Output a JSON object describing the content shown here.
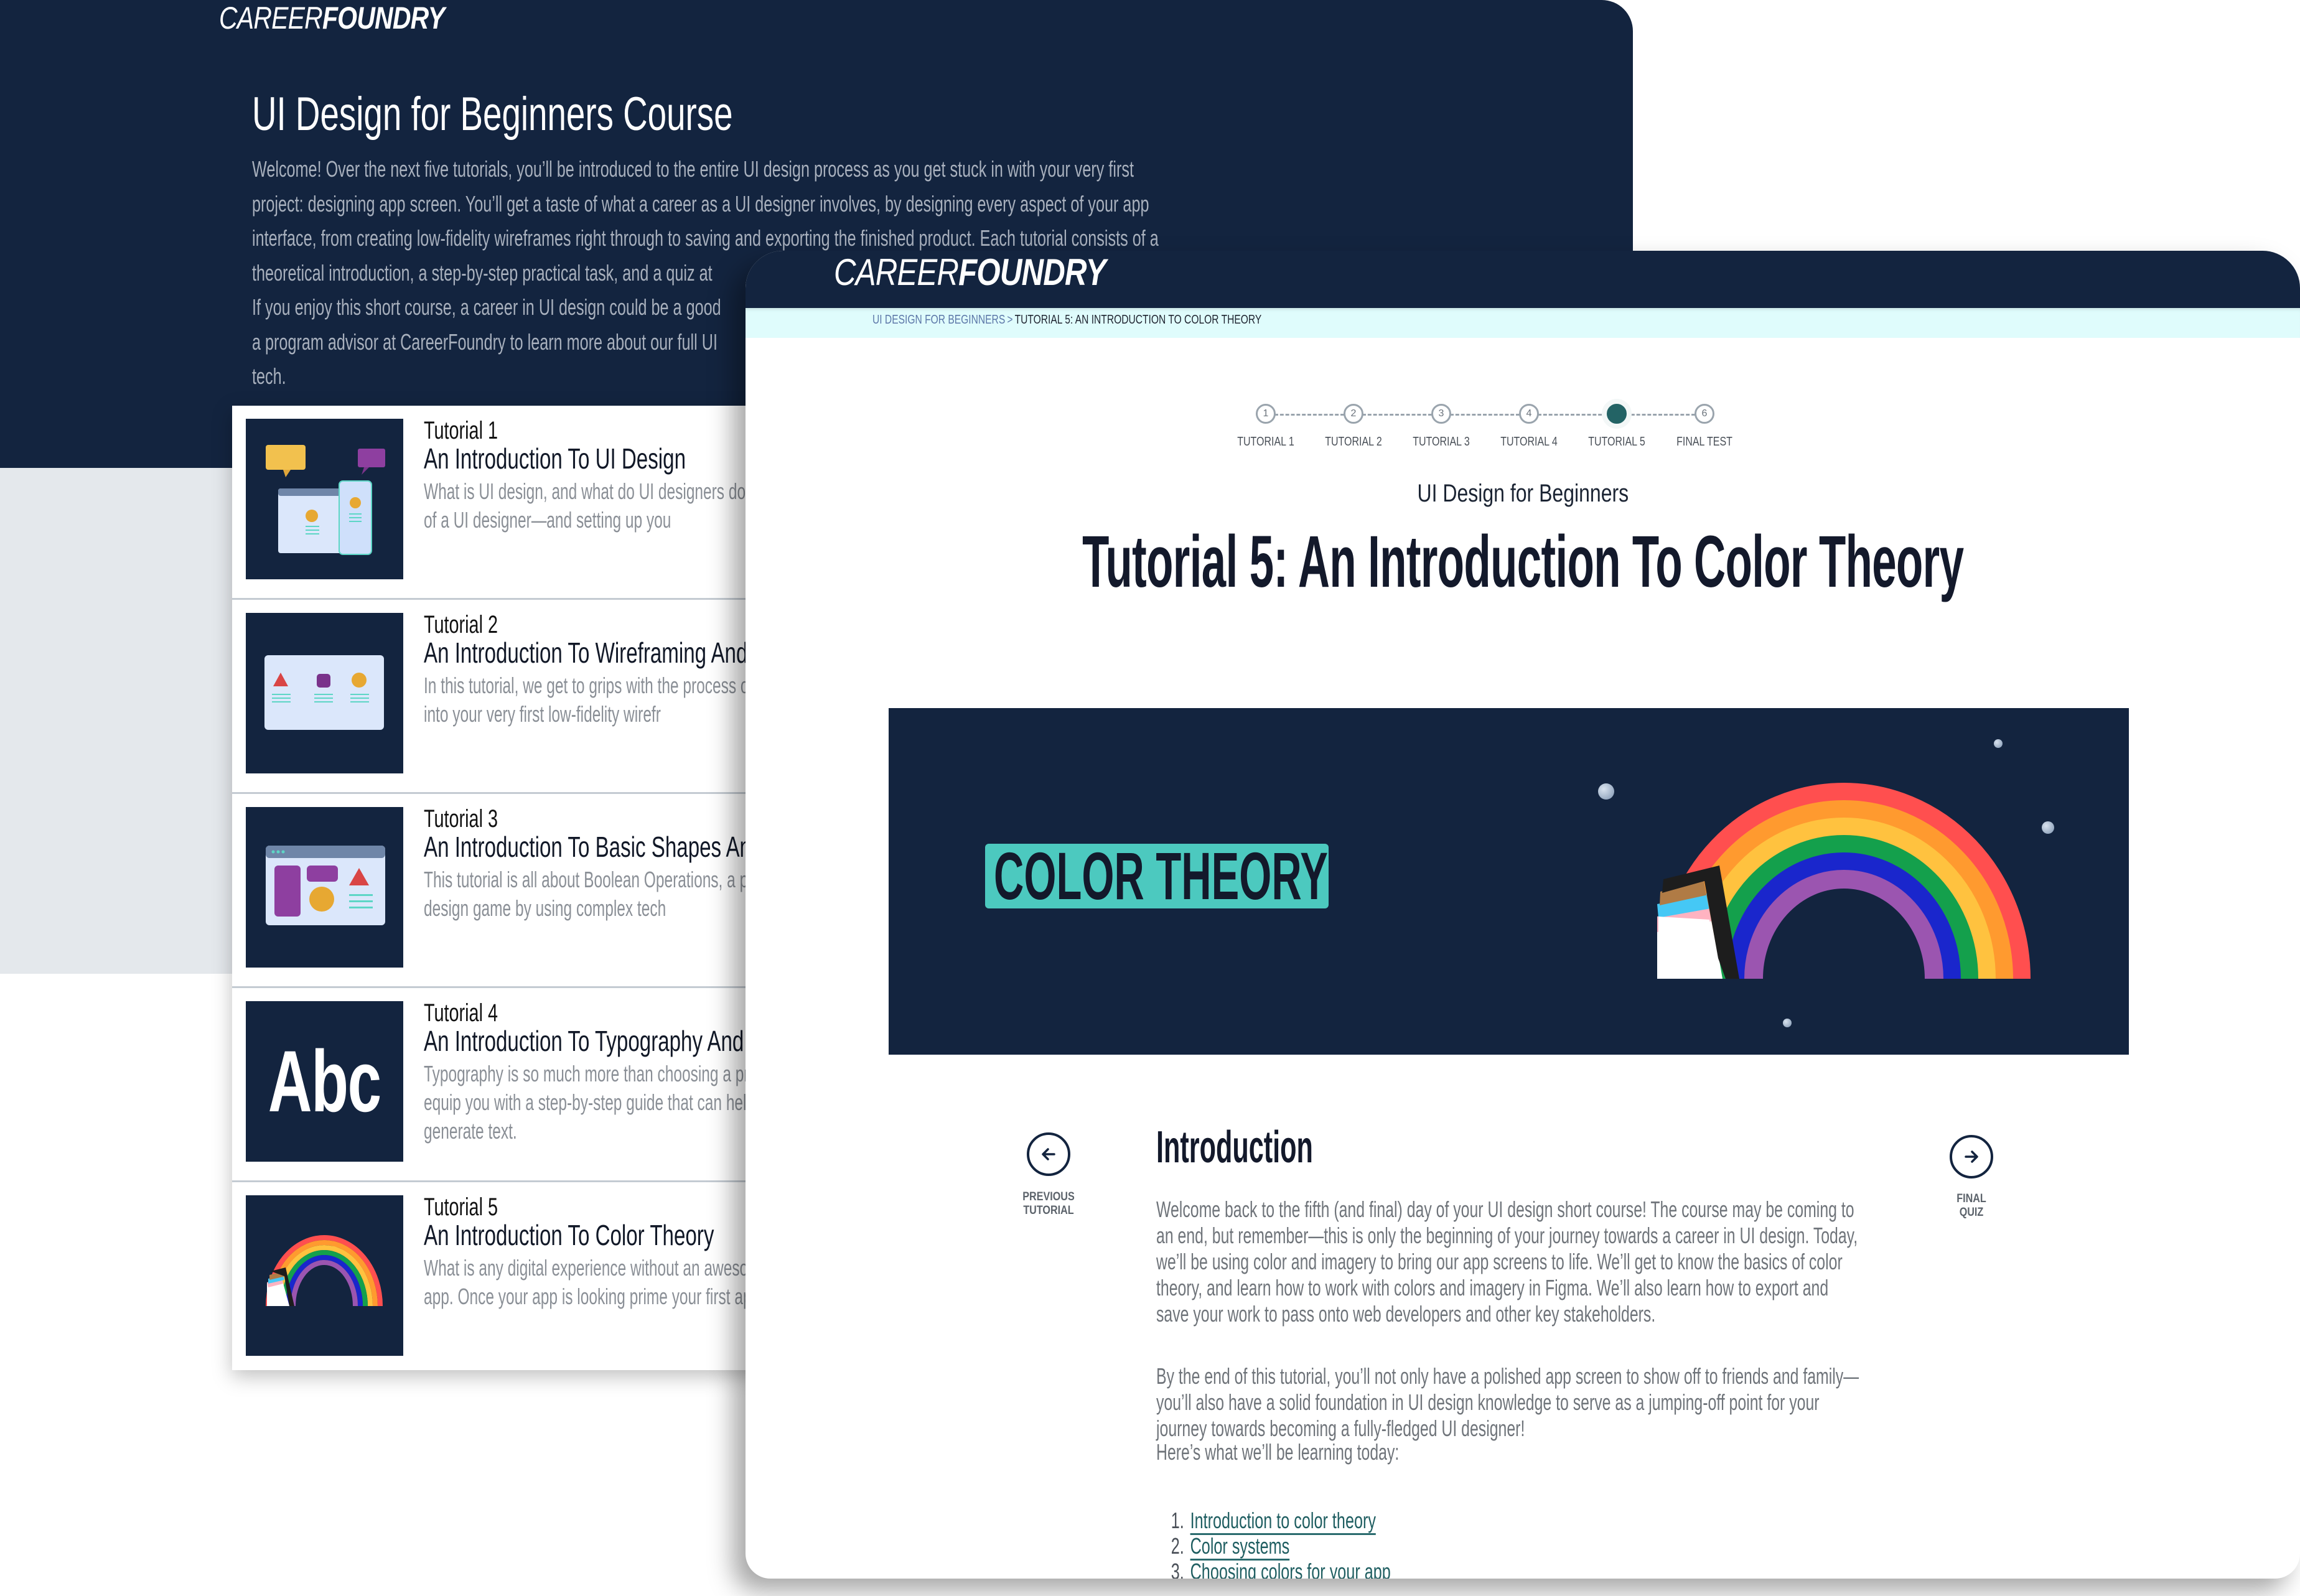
{
  "brand": {
    "light": "CAREER",
    "bold": "FOUNDRY"
  },
  "colors": {
    "navy": "#13243f",
    "teal_accent": "#236365",
    "label_bg": "#4cc9bf",
    "breadcrumb_bg": "#dffcfc",
    "link": "#1f5e61"
  },
  "course_page": {
    "title": "UI Design for Beginners Course",
    "description": "Welcome! Over the next five tutorials, you’ll be introduced to the entire UI design process as you get stuck in with your very first project: designing app screen. You’ll get a taste of what a career as a UI designer involves, by designing every aspect of your app interface, from creating low-fidelity wireframes right through to saving and exporting the finished product. Each tutorial consists of a theoretical introduction, a step-by-step practical task, and a quiz at",
    "description_line5": "If you enjoy this short course, a career in UI design could be a good",
    "description_line6": "a program advisor at CareerFoundry to learn more about our full UI",
    "description_line7": "tech.",
    "tutorials": [
      {
        "number": "Tutorial 1",
        "title": "An Introduction To UI Design",
        "description": "What is UI design, and what do UI designers do? We responsibilities of a UI designer—and setting up you",
        "thumb": "ui-design-illustration"
      },
      {
        "number": "Tutorial 2",
        "title": "An Introduction To Wireframing And UI E",
        "description": "In this tutorial, we get to grips with the process of wi design elements into your very first low-fidelity wirefr",
        "thumb": "wireframe-illustration"
      },
      {
        "number": "Tutorial 3",
        "title": "An Introduction To Basic Shapes And Di",
        "description": "This tutorial is all about Boolean Operations, a powe level-up your UI design game by using complex tech",
        "thumb": "shapes-illustration"
      },
      {
        "number": "Tutorial 4",
        "title": "An Introduction To Typography And Type",
        "description": "Typography is so much more than choosing a pretty techniques and equip you with a step-by-step guide that can help pair fonts and generate text.",
        "thumb": "abc-typography",
        "thumb_text": "Abc"
      },
      {
        "number": "Tutorial 5",
        "title": "An Introduction To Color Theory",
        "description": "What is any digital experience without an awesome c climate change app. Once your app is looking prime your first app interface!",
        "thumb": "rainbow-illustration"
      }
    ]
  },
  "tutorial_page": {
    "breadcrumb": {
      "parent": "UI DESIGN FOR BEGINNERS",
      "separator": ">",
      "current": "TUTORIAL 5: AN INTRODUCTION TO COLOR THEORY"
    },
    "stepper": {
      "steps": [
        {
          "num": "1",
          "label": "TUTORIAL 1"
        },
        {
          "num": "2",
          "label": "TUTORIAL 2"
        },
        {
          "num": "3",
          "label": "TUTORIAL 3"
        },
        {
          "num": "4",
          "label": "TUTORIAL 4"
        },
        {
          "num": "5",
          "label": "TUTORIAL 5"
        },
        {
          "num": "6",
          "label": "FINAL TEST"
        }
      ],
      "active_step": 5
    },
    "course_subtitle": "UI Design for Beginners",
    "title": "Tutorial 5: An Introduction To Color Theory",
    "hero_label": "COLOR THEORY",
    "prev_label_1": "PREVIOUS",
    "prev_label_2": "TUTORIAL",
    "next_label_1": "FINAL",
    "next_label_2": "QUIZ",
    "intro_heading": "Introduction",
    "paragraphs": [
      "Welcome back to the fifth (and final) day of your UI design short course! The course may be coming to an end, but remember—this is only the beginning of your journey towards a career in UI design. Today, we’ll be using color and imagery to bring our app screens to life. We’ll get to know the basics of color theory, and learn how to work with colors and imagery in Figma. We’ll also learn how to export and save your work to pass onto web developers and other key stakeholders.",
      "By the end of this tutorial, you’ll not only have a polished app screen to show off to friends and family—you’ll also have a solid foundation in UI design knowledge to serve as a jumping-off point for your journey towards becoming a fully-fledged UI designer!",
      "Here’s what we’ll be learning today:"
    ],
    "learning_list": [
      "Introduction to color theory",
      "Color systems",
      "Choosing colors for your app"
    ]
  }
}
